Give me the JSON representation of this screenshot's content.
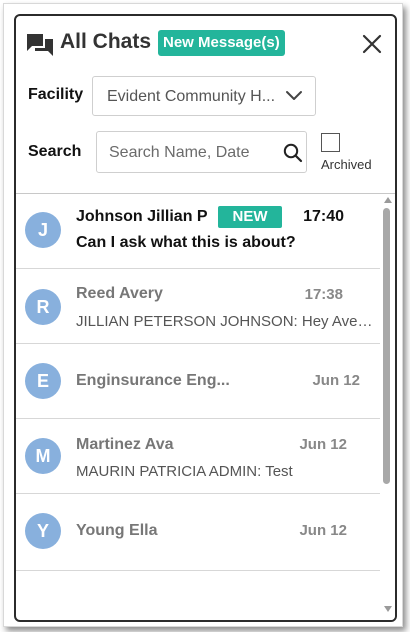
{
  "header": {
    "title": "All Chats",
    "new_badge": "New Message(s)",
    "chat_icon": "chat-bubbles-icon",
    "close_icon": "close-icon"
  },
  "facility": {
    "label": "Facility",
    "value": "Evident Community H...",
    "icon": "chevron-down-icon"
  },
  "search": {
    "label": "Search",
    "placeholder": "Search Name, Date",
    "value": "",
    "icon": "search-icon"
  },
  "archived": {
    "label": "Archived",
    "checked": false
  },
  "colors": {
    "accent": "#23b59b",
    "avatar": "#88b0dd"
  },
  "chats": [
    {
      "initial": "J",
      "name": "Johnson Jillian P",
      "badge": "NEW",
      "time": "17:40",
      "preview": "Can I ask what this is about?",
      "unread": true
    },
    {
      "initial": "R",
      "name": "Reed Avery",
      "badge": "",
      "time": "17:38",
      "preview": "JILLIAN PETERSON JOHNSON: Hey Avery...",
      "unread": false
    },
    {
      "initial": "E",
      "name": "Enginsurance Eng...",
      "badge": "",
      "time": "Jun 12",
      "preview": "",
      "unread": false
    },
    {
      "initial": "M",
      "name": "Martinez Ava",
      "badge": "",
      "time": "Jun 12",
      "preview": "MAURIN PATRICIA ADMIN: Test",
      "unread": false
    },
    {
      "initial": "Y",
      "name": "Young Ella",
      "badge": "",
      "time": "Jun 12",
      "preview": "",
      "unread": false
    }
  ]
}
